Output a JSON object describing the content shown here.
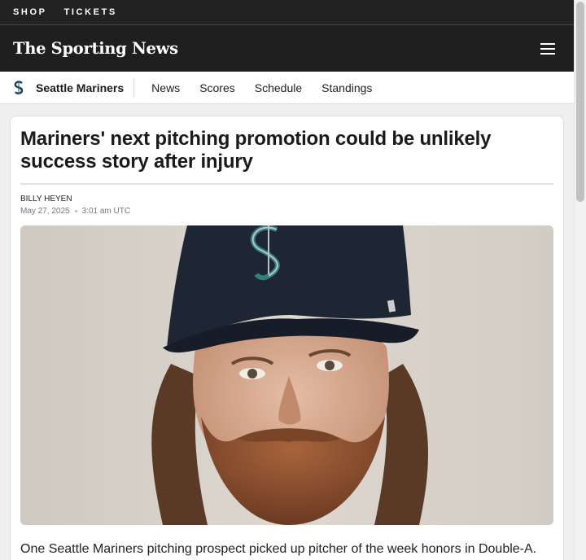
{
  "topbar": {
    "shop": "SHOP",
    "tickets": "TICKETS"
  },
  "brand": {
    "logo": "The Sporting News",
    "menu_icon": "hamburger-menu-icon"
  },
  "team_nav": {
    "team_name": "Seattle Mariners",
    "team_logo_icon": "mariners-logo-icon",
    "links": [
      "News",
      "Scores",
      "Schedule",
      "Standings"
    ]
  },
  "article": {
    "headline": "Mariners' next pitching promotion could be unlikely success story after injury",
    "author": "BILLY HEYEN",
    "date": "May 27, 2025",
    "time": "3:01 am UTC",
    "lede": "One Seattle Mariners pitching prospect picked up pitcher of the week honors in Double-A."
  },
  "colors": {
    "topbar_bg": "#222222",
    "brand_bg": "#1f1f1f",
    "cap_navy": "#1e2634",
    "cap_teal": "#2f7f7a"
  }
}
